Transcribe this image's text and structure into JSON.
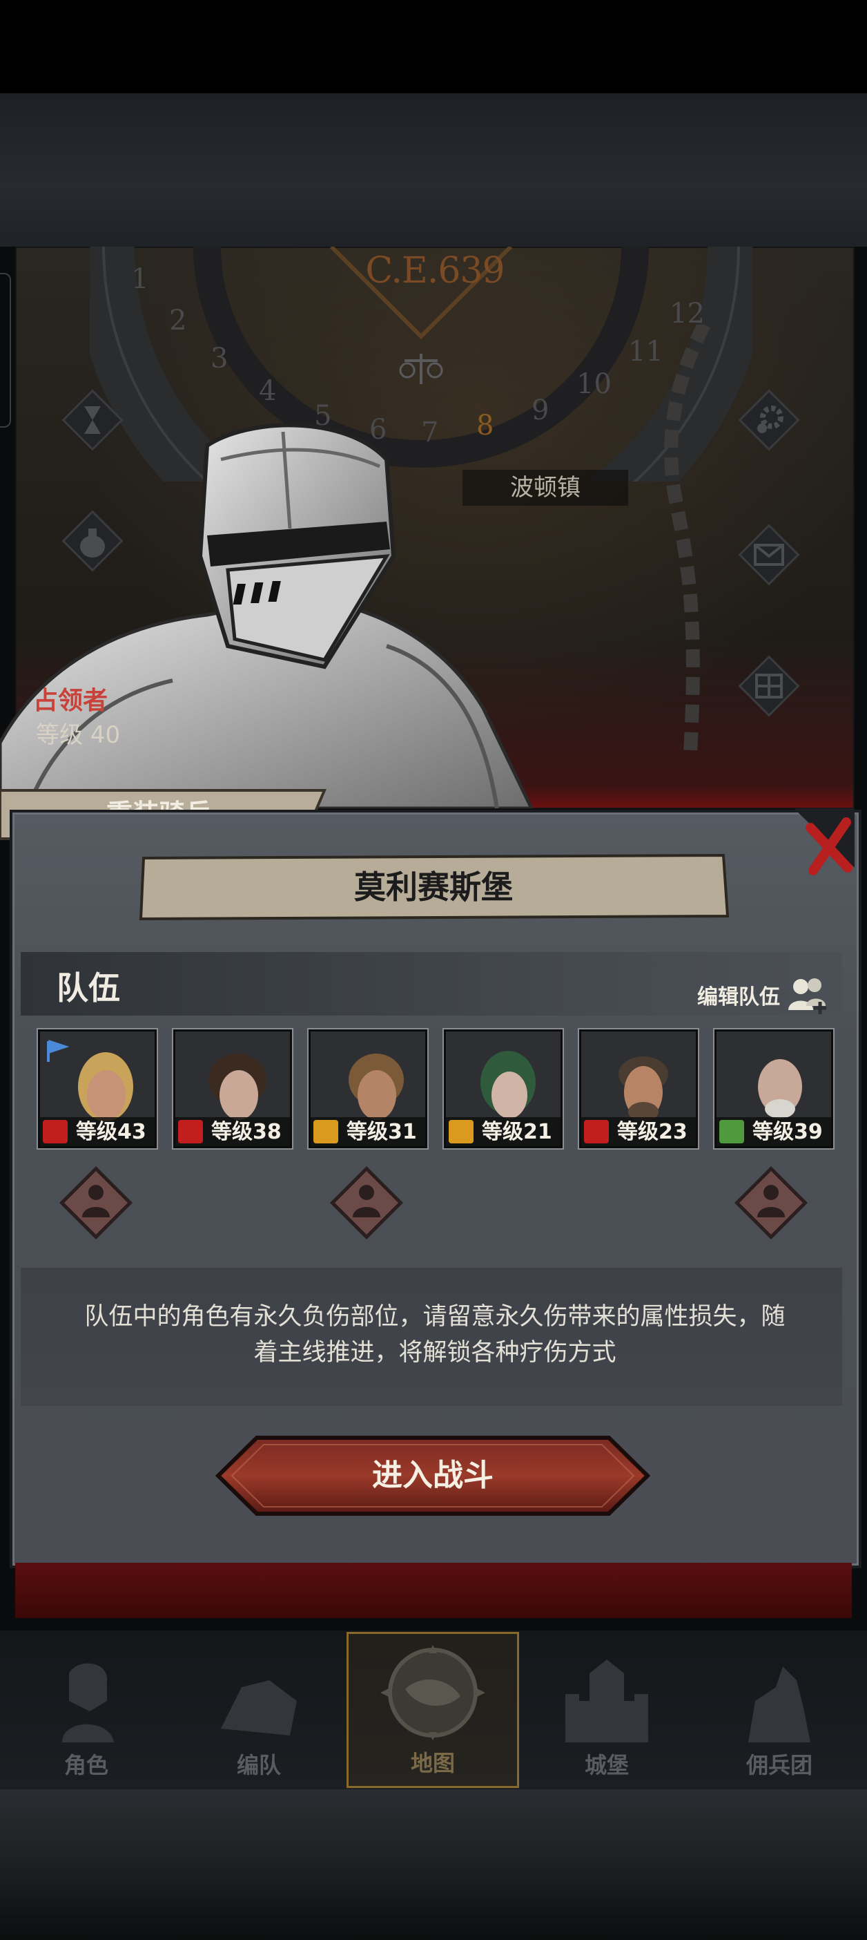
{
  "map": {
    "era": "C.E.639",
    "dial_numbers": [
      "1",
      "2",
      "3",
      "4",
      "5",
      "6",
      "7",
      "8",
      "9",
      "10",
      "11",
      "12"
    ],
    "current_number": "8",
    "town": "波顿镇"
  },
  "enemy": {
    "occupier_label": "占领者",
    "level_text": "等级 40",
    "unit_name": "重装骑兵"
  },
  "dialog": {
    "title": "莫利赛斯堡",
    "team_label": "队伍",
    "edit_team_label": "编辑队伍",
    "members": [
      {
        "level_text": "等级43",
        "class": "cavalry",
        "badge_color": "#c21e1e"
      },
      {
        "level_text": "等级38",
        "class": "cavalry",
        "badge_color": "#c21e1e"
      },
      {
        "level_text": "等级31",
        "class": "shield",
        "badge_color": "#d99a1e"
      },
      {
        "level_text": "等级21",
        "class": "shield",
        "badge_color": "#d99a1e"
      },
      {
        "level_text": "等级23",
        "class": "cavalry",
        "badge_color": "#c21e1e"
      },
      {
        "level_text": "等级39",
        "class": "archer",
        "badge_color": "#4f9a3c"
      }
    ],
    "info_line1": "队伍中的角色有永久负伤部位，请留意永久伤带来的属性损失，随",
    "info_line2": "着主线推进，将解锁各种疗伤方式",
    "battle_button": "进入战斗"
  },
  "nav": {
    "items": [
      {
        "label": "角色",
        "icon": "knight-icon"
      },
      {
        "label": "编队",
        "icon": "formation-icon"
      },
      {
        "label": "地图",
        "icon": "compass-map-icon",
        "active": true
      },
      {
        "label": "城堡",
        "icon": "castle-icon"
      },
      {
        "label": "佣兵团",
        "icon": "mercenary-icon"
      }
    ]
  },
  "colors": {
    "accent_red": "#c9423a",
    "gold": "#8a6a2a",
    "dialog_bg": "#4d5157"
  }
}
